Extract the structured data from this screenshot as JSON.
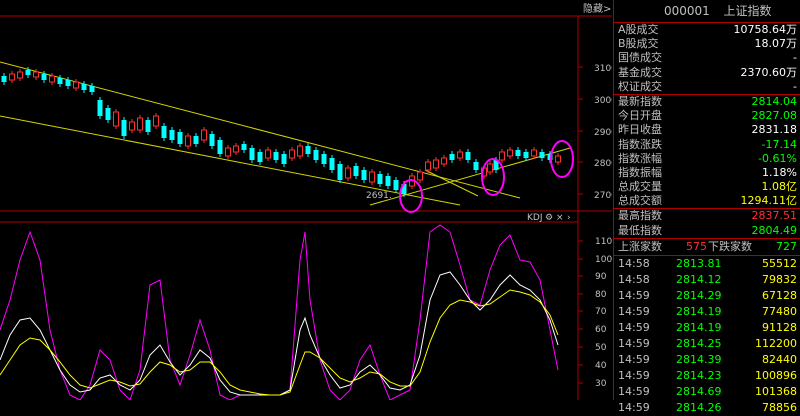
{
  "top_strip": {
    "label": "隐藏>>"
  },
  "chart": {
    "price_axis": [
      "3100",
      "3000",
      "2900",
      "2800",
      "2700"
    ],
    "indicator_axis": [
      "110",
      "100",
      "90",
      "80",
      "70",
      "60",
      "50",
      "40",
      "30"
    ],
    "annotation_low": "2691.",
    "indicator_name": "KDJ",
    "colors": {
      "up": "#ff3030",
      "down": "#00ffff",
      "trend": "#d4d400",
      "circle": "#ff00ff",
      "k_line": "#ffffff",
      "d_line": "#ffff00",
      "j_line": "#ff00ff",
      "border": "#b00000"
    }
  },
  "panel": {
    "code": "000001",
    "name": "上证指数",
    "stats_a": [
      {
        "label": "A股成交",
        "value": "10758.64万",
        "cls": "white"
      },
      {
        "label": "B股成交",
        "value": "18.07万",
        "cls": "white"
      },
      {
        "label": "国债成交",
        "value": "-",
        "cls": "white"
      },
      {
        "label": "基金成交",
        "value": "2370.60万",
        "cls": "white"
      },
      {
        "label": "权证成交",
        "value": "-",
        "cls": "white"
      }
    ],
    "stats_b": [
      {
        "label": "最新指数",
        "value": "2814.04",
        "cls": "green"
      },
      {
        "label": "今日开盘",
        "value": "2827.08",
        "cls": "green"
      },
      {
        "label": "昨日收盘",
        "value": "2831.18",
        "cls": "white"
      },
      {
        "label": "指数涨跌",
        "value": "-17.14",
        "cls": "green"
      },
      {
        "label": "指数涨幅",
        "value": "-0.61%",
        "cls": "green"
      },
      {
        "label": "指数振幅",
        "value": "1.18%",
        "cls": "white"
      },
      {
        "label": "总成交量",
        "value": "1.08亿",
        "cls": "yellow"
      },
      {
        "label": "总成交额",
        "value": "1294.11亿",
        "cls": "yellow"
      }
    ],
    "stats_c": [
      {
        "label": "最高指数",
        "value": "2837.51",
        "cls": "red"
      },
      {
        "label": "最低指数",
        "value": "2804.49",
        "cls": "green"
      }
    ],
    "up_label": "上涨家数",
    "up_count": "575",
    "down_label": "下跌家数",
    "down_count": "727",
    "ticks": [
      {
        "time": "14:58",
        "price": "2813.81",
        "vol": "55512"
      },
      {
        "time": "14:58",
        "price": "2814.12",
        "vol": "79832"
      },
      {
        "time": "14:59",
        "price": "2814.29",
        "vol": "67128"
      },
      {
        "time": "14:59",
        "price": "2814.19",
        "vol": "77480"
      },
      {
        "time": "14:59",
        "price": "2814.19",
        "vol": "91128"
      },
      {
        "time": "14:59",
        "price": "2814.25",
        "vol": "112200"
      },
      {
        "time": "14:59",
        "price": "2814.39",
        "vol": "82440"
      },
      {
        "time": "14:59",
        "price": "2814.23",
        "vol": "100896"
      },
      {
        "time": "14:59",
        "price": "2814.69",
        "vol": "101368"
      },
      {
        "time": "14:59",
        "price": "2814.26",
        "vol": "78856"
      }
    ]
  }
}
